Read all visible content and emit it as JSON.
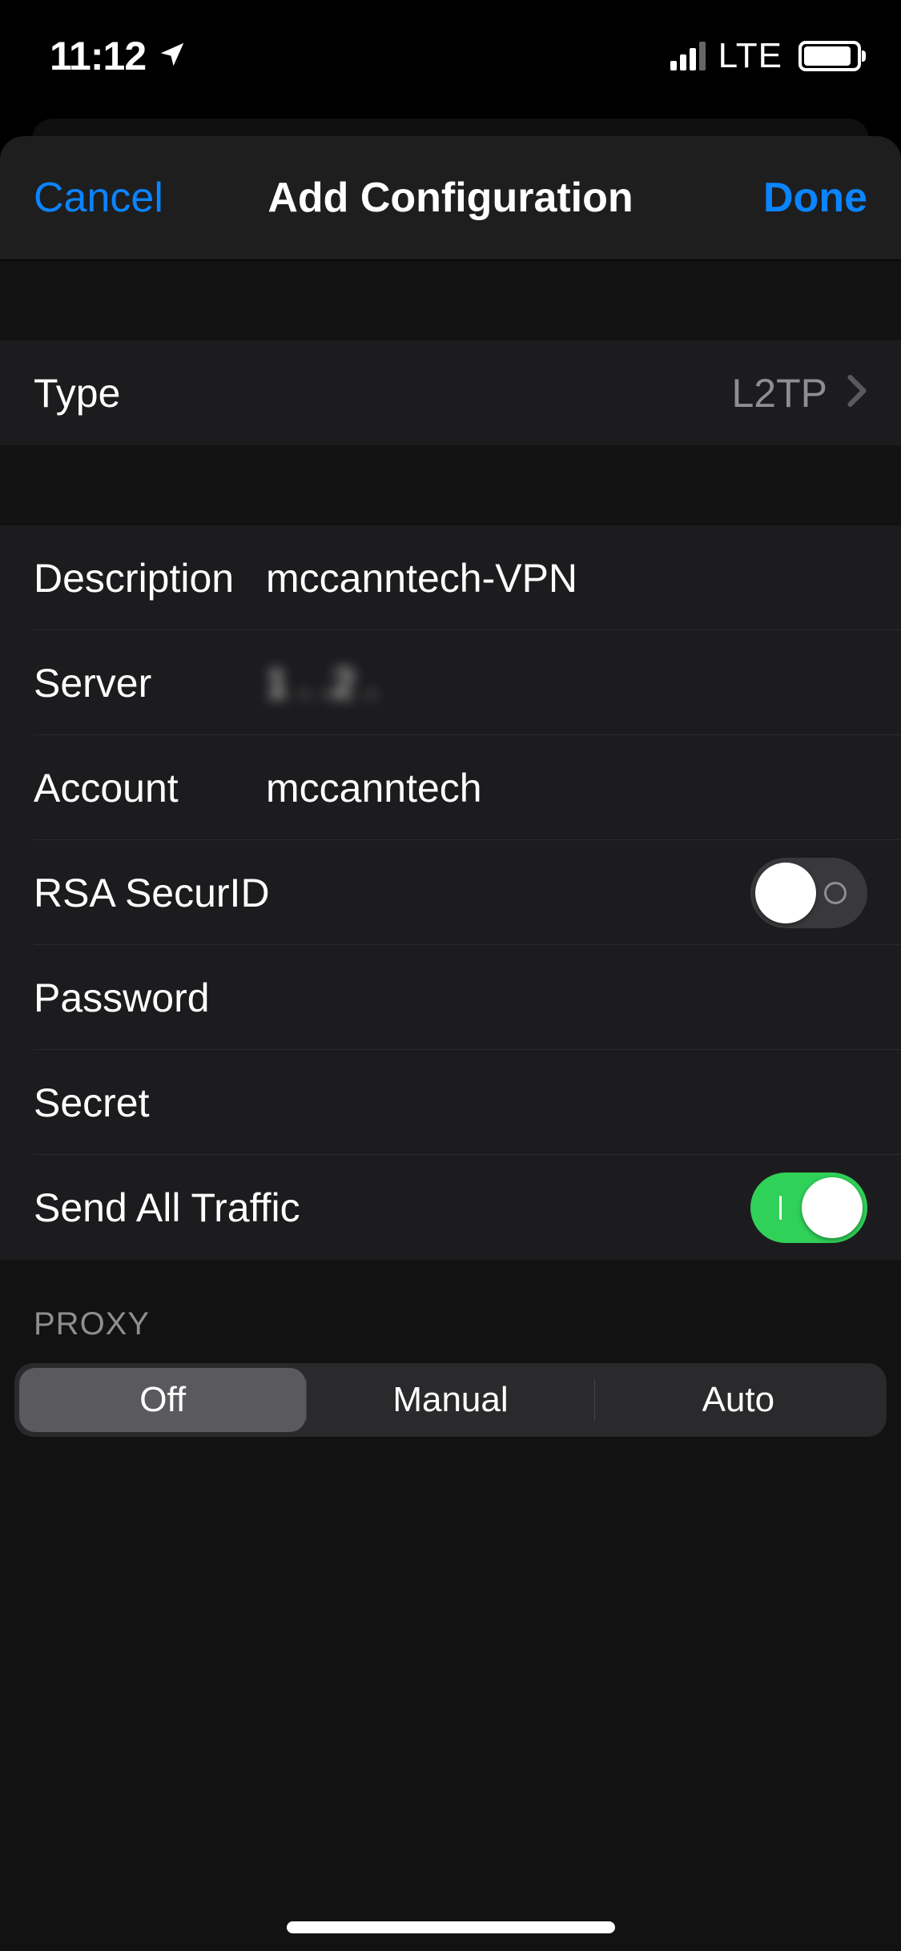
{
  "status": {
    "time": "11:12",
    "network_label": "LTE"
  },
  "nav": {
    "cancel": "Cancel",
    "title": "Add Configuration",
    "done": "Done"
  },
  "type_row": {
    "label": "Type",
    "value": "L2TP"
  },
  "fields": {
    "description": {
      "label": "Description",
      "value": "mccanntech-VPN"
    },
    "server": {
      "label": "Server",
      "value": "1   .    .2   .   "
    },
    "account": {
      "label": "Account",
      "value": "mccanntech"
    },
    "rsa": {
      "label": "RSA SecurID"
    },
    "password": {
      "label": "Password"
    },
    "secret": {
      "label": "Secret"
    },
    "send_all": {
      "label": "Send All Traffic"
    }
  },
  "toggles": {
    "rsa_on": false,
    "send_all_on": true
  },
  "proxy": {
    "header": "PROXY",
    "options": [
      "Off",
      "Manual",
      "Auto"
    ],
    "selected_index": 0
  }
}
